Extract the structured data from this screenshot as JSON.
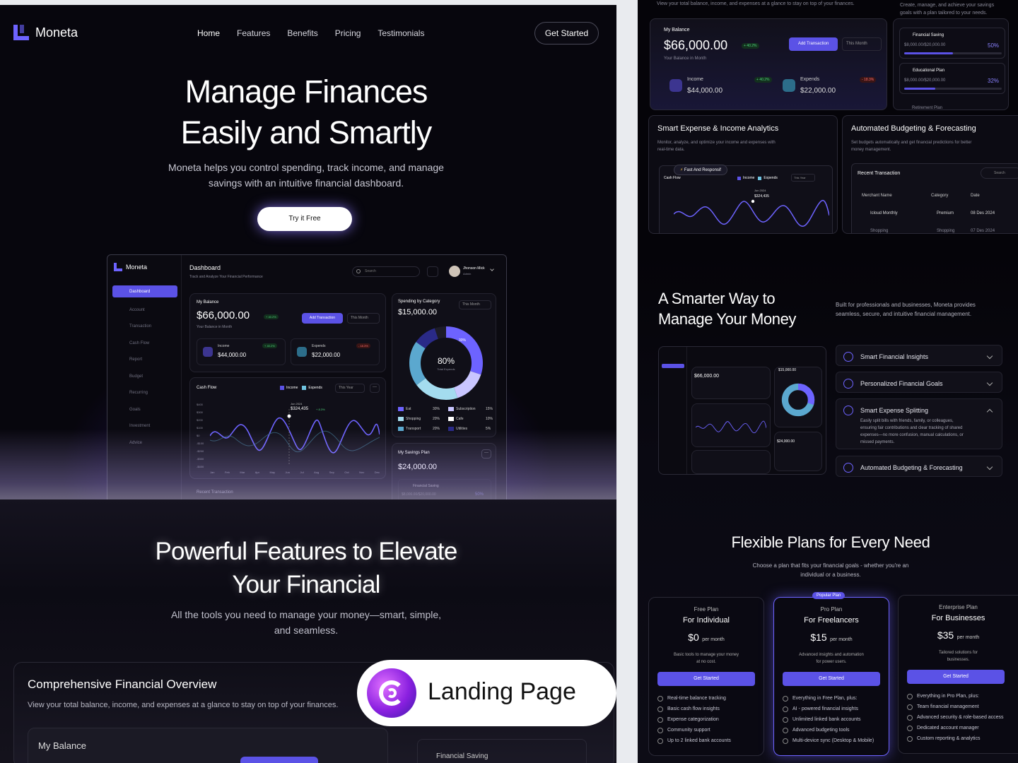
{
  "brand": {
    "name": "Moneta"
  },
  "nav": {
    "items": [
      "Home",
      "Features",
      "Benefits",
      "Pricing",
      "Testimonials"
    ],
    "cta": "Get Started"
  },
  "hero": {
    "title_line1": "Manage Finances",
    "title_line2": "Easily and Smartly",
    "subtitle_line1": "Moneta helps you control spending, track income, and manage",
    "subtitle_line2": "savings with an intuitive financial dashboard.",
    "cta": "Try it Free"
  },
  "dashboard": {
    "title": "Dashboard",
    "subtitle": "Track and Analyze Your Financial Performance",
    "search": "Search",
    "user_name": "Jhonson Mick",
    "user_role": "Admin",
    "sidebar": [
      "Dashboard",
      "Account",
      "Transaction",
      "Cash Flow",
      "Report",
      "Budget",
      "Recurring",
      "Goals",
      "Investment",
      "Advice"
    ],
    "balance_label": "My Balance",
    "balance": "$66,000.00",
    "balance_change": "+ 40.2%",
    "balance_sub": "Your Balance in Month",
    "add_tx": "Add Transaction",
    "period": "This Month",
    "income_label": "Income",
    "income": "$44,000.00",
    "income_change": "+ 40.2%",
    "expends_label": "Expends",
    "expends": "$22,000.00",
    "expends_change": "- 18.3%",
    "spending_label": "Spending by Category",
    "spending": "$15,000.00",
    "donut_pct": "80%",
    "donut_sub": "Total Expends",
    "donut_tag": "30%",
    "categories": [
      [
        "Eat",
        "30%"
      ],
      [
        "Subscription",
        "15%"
      ],
      [
        "Shopping",
        "20%"
      ],
      [
        "Cafe",
        "10%"
      ],
      [
        "Transport",
        "20%"
      ],
      [
        "Utilities",
        "5%"
      ]
    ],
    "cash_label": "Cash Flow",
    "legend_income": "Income",
    "legend_expends": "Expends",
    "year": "This Year",
    "tip_date": "Jun 2024",
    "tip_value": "$324,435",
    "tip_change": "+ 8.3%",
    "y_ticks": [
      "$400",
      "$300",
      "$200",
      "$100",
      "$0",
      "-$100",
      "-$200",
      "-$300",
      "-$400"
    ],
    "months": [
      "Jan",
      "Feb",
      "Mar",
      "Apr",
      "May",
      "Jun",
      "Jul",
      "Aug",
      "Sep",
      "Oct",
      "Nov",
      "Dec"
    ],
    "savings_label": "My Savings Plan",
    "savings": "$24,000.00",
    "saving_item": "Financial Saving",
    "saving_amount": "$8,000.00/$20,000.00",
    "saving_pct": "50%",
    "recent": "Recent Transaction"
  },
  "features": {
    "title_line1": "Powerful Features to Elevate",
    "title_line2": "Your Financial",
    "subtitle_line1": "All the tools you need to manage your money—smart, simple,",
    "subtitle_line2": "and seamless.",
    "overview_title": "Comprehensive Financial Overview",
    "overview_desc": "View your total balance, income, and expenses at a glance to stay on top of your finances.",
    "overview_balance": "My Balance",
    "overview_saving": "Financial Saving"
  },
  "badge": {
    "text": "Landing Page"
  },
  "right": {
    "top_desc_left": "View your total balance, income, and expenses at a glance to stay on top of your finances.",
    "top_desc_right_1": "Create, manage, and achieve your savings",
    "top_desc_right_2": "goals with a plan tailored to your needs.",
    "plans": [
      {
        "name": "Financial Saving",
        "amount": "$8,000.00/$20,000.00",
        "pct": "50%"
      },
      {
        "name": "Educational Plan",
        "amount": "$8,000.00/$20,000.00",
        "pct": "32%"
      },
      {
        "name": "Retirement Plan"
      }
    ],
    "analytics_title": "Smart Expense & Income Analytics",
    "analytics_desc_1": "Monitor, analyze, and optimize your income and expenses with",
    "analytics_desc_2": "real-time data.",
    "analytics_tag": "Fast And Responsif",
    "budget_title": "Automated Budgeting & Forecasting",
    "budget_desc_1": "Set budgets automatically and get financial predictions for better",
    "budget_desc_2": "money management.",
    "recent_title": "Recent Transaction",
    "recent_search": "Search",
    "recent_cols": [
      "Merchant Name",
      "Category",
      "Date"
    ],
    "recent_rows": [
      [
        "Icloud Monthly",
        "Premium",
        "08 Des 2024"
      ],
      [
        "Shopping",
        "Shopping",
        "07 Des 2024"
      ]
    ],
    "smarter_title_1": "A Smarter Way to",
    "smarter_title_2": "Manage Your Money",
    "smarter_desc_1": "Built for professionals and businesses, Moneta provides",
    "smarter_desc_2": "seamless, secure, and intuitive financial management.",
    "accordion": [
      "Smart Financial Insights",
      "Personalized Financial Goals",
      "Smart Expense Splitting",
      "Automated Budgeting & Forecasting"
    ],
    "accordion_open_1": "Easily split bills with friends, family, or colleagues,",
    "accordion_open_2": "ensuring fair contributions and clear tracking of shared",
    "accordion_open_3": "expenses—no more confusion, manual calculations, or",
    "accordion_open_4": "missed payments.",
    "pricing_title": "Flexible Plans for Every Need",
    "pricing_desc_1": "Choose a plan that fits your financial goals - whether you're an",
    "pricing_desc_2": "individual or a business.",
    "tiers": [
      {
        "tier": "Free Plan",
        "for": "For Individual",
        "price": "$0",
        "per": "per month",
        "desc_1": "Basic tools to manage your money",
        "desc_2": "at no cost.",
        "cta": "Get Started",
        "features": [
          "Real-time balance tracking",
          "Basic cash flow insights",
          "Expense categorization",
          "Community support",
          "Up to 2 linked bank accounts"
        ]
      },
      {
        "tier": "Pro Plan",
        "badge": "Popular Plan",
        "for": "For Freelancers",
        "price": "$15",
        "per": "per month",
        "desc_1": "Advanced insights and automation",
        "desc_2": "for power users.",
        "cta": "Get Started",
        "features": [
          "Everything in Free Plan, plus:",
          "AI - powered financial insights",
          "Unlimited linked bank accounts",
          "Advanced budgeting tools",
          "Multi-device sync (Desktop & Mobile)"
        ]
      },
      {
        "tier": "Enterprise Plan",
        "for": "For Businesses",
        "price": "$35",
        "per": "per month",
        "desc_1": "Tailored solutions for",
        "desc_2": "businesses.",
        "cta": "Get Started",
        "features": [
          "Everything in Pro Plan, plus:",
          "Team financial management",
          "Advanced security & role-based access",
          "Dedicated account manager",
          "Custom reporting & analytics"
        ]
      }
    ]
  },
  "colors": {
    "accent": "#5b52e6",
    "background": "#07060d",
    "income": "#5b52e6",
    "expends": "#6fc3e0"
  }
}
